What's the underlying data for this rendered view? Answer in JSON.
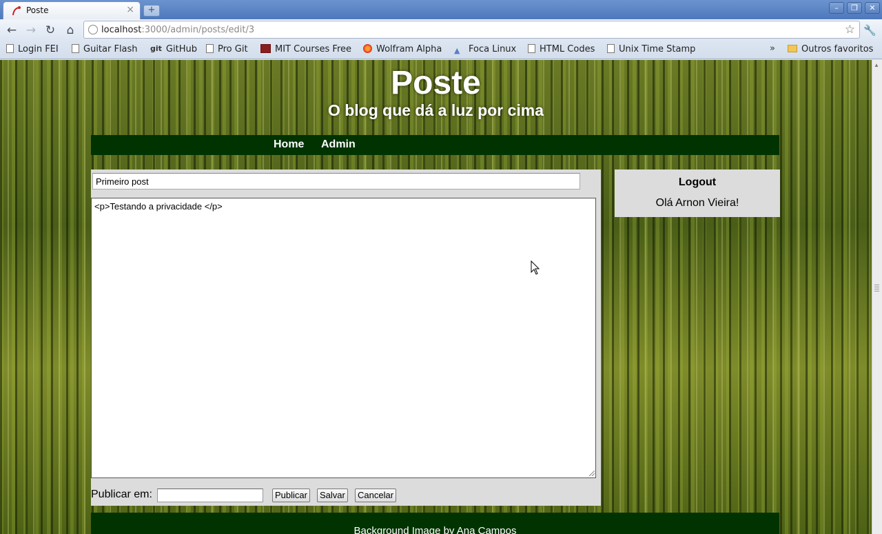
{
  "browser": {
    "tab_title": "Poste",
    "tab_close": "×",
    "new_tab": "+",
    "url_host": "localhost",
    "url_path": ":3000/admin/posts/edit/3",
    "bookmarks": [
      "Login FEI",
      "Guitar Flash",
      "GitHub",
      "Pro Git",
      "MIT Courses Free",
      "Wolfram Alpha",
      "Foca Linux",
      "HTML Codes",
      "Unix Time Stamp"
    ],
    "bookmarks_more": "»",
    "other_bookmarks": "Outros favoritos",
    "git_logo_text": "git"
  },
  "site": {
    "title": "Poste",
    "tagline": "O blog que dá a luz por cima"
  },
  "nav": {
    "home": "Home",
    "admin": "Admin"
  },
  "post_form": {
    "title_value": "Primeiro post",
    "body_value": "<p>Testando a privacidade </p>",
    "publish_label": "Publicar em:",
    "publish_value": "",
    "publish_button": "Publicar",
    "save_button": "Salvar",
    "cancel_button": "Cancelar"
  },
  "sidebar": {
    "logout": "Logout",
    "greeting": "Olá Arnon Vieira!"
  },
  "footer": {
    "credit": "Background Image by Ana Campos"
  },
  "colors": {
    "nav_bg": "#003300",
    "panel_bg": "#dcdcdc",
    "chrome_blue": "#4d78bb"
  }
}
